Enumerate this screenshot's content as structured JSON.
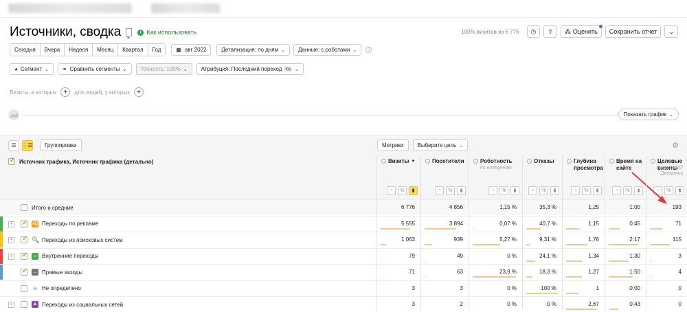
{
  "header": {
    "title": "Источники, сводка",
    "how_to": "Как использовать",
    "visits_pct": "100% визитов из 6 776",
    "rate_label": "Оценить",
    "save_report": "Сохранить отчет"
  },
  "period": {
    "buttons": [
      "Сегодня",
      "Вчера",
      "Неделя",
      "Месяц",
      "Квартал",
      "Год"
    ],
    "date": "авг 2022",
    "detail": "Детализация: по дням",
    "data": "Данные: с роботами"
  },
  "segments": {
    "segment": "Сегмент",
    "compare": "Сравнить сегменты",
    "accuracy": "Точность: 100%",
    "attribution": "Атрибуция: Последний переход",
    "attribution_tag": "КД"
  },
  "filters": {
    "visits_label": "Визиты, в которых",
    "people_label": "для людей, у которых"
  },
  "graph": {
    "show": "Показать график"
  },
  "toolbar": {
    "groupings": "Группировки",
    "metrics": "Метрики",
    "goal": "Выберите цель"
  },
  "table": {
    "dimension": "Источник трафика, Источник трафика (детально)",
    "columns": [
      {
        "name": "Визиты",
        "sort": "▼",
        "sub": ""
      },
      {
        "name": "Посетители",
        "sort": "",
        "sub": ""
      },
      {
        "name": "Роботность",
        "sort": "",
        "sub": "по поведению"
      },
      {
        "name": "Отказы",
        "sort": "",
        "sub": ""
      },
      {
        "name": "Глубина просмотра",
        "sort": "",
        "sub": ""
      },
      {
        "name": "Время на сайте",
        "sort": "",
        "sub": ""
      },
      {
        "name": "Целевые визиты",
        "sort": "",
        "sub": "Лид с сайт// Динамика"
      }
    ],
    "total": {
      "label": "Итого и средние",
      "values": [
        "6 776",
        "4 856",
        "1,15 %",
        "35,3 %",
        "1,25",
        "1:00",
        "193"
      ]
    },
    "rows": [
      {
        "label": "Переходы по рекламе",
        "icon": "ad-icon",
        "color": "#4caf50",
        "values": [
          "5 555",
          "3 894",
          "0,07 %",
          "40,7 %",
          "1,15",
          "0:45",
          "71"
        ]
      },
      {
        "label": "Переходы из поисковых систем",
        "icon": "search-icon",
        "color": "#ffc107",
        "values": [
          "1 063",
          "939",
          "5,27 %",
          "9,31 %",
          "1,76",
          "2:17",
          "115"
        ]
      },
      {
        "label": "Внутренние переходы",
        "icon": "home-icon",
        "color": "#f44336",
        "values": [
          "79",
          "49",
          "0 %",
          "24,1 %",
          "1,34",
          "1:30",
          "3"
        ]
      },
      {
        "label": "Прямые заходы",
        "icon": "arrow-icon",
        "color": "#5c9bd1",
        "values": [
          "71",
          "63",
          "23,9 %",
          "18,3 %",
          "1,27",
          "1:50",
          "4"
        ]
      },
      {
        "label": "Не определено",
        "icon": "spinner-icon",
        "color": "",
        "values": [
          "3",
          "3",
          "0 %",
          "100 %",
          "1",
          "0:00",
          "0"
        ]
      },
      {
        "label": "Переходы из социальных сетей",
        "icon": "social-icon",
        "color": "",
        "values": [
          "3",
          "2",
          "0 %",
          "0 %",
          "2,67",
          "0:43",
          "0"
        ]
      }
    ]
  }
}
